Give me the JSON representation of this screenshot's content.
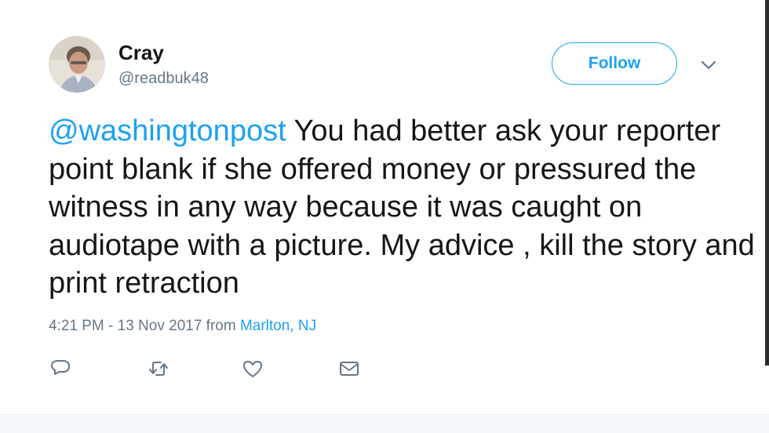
{
  "user": {
    "display_name": "Cray",
    "handle": "@readbuk48",
    "avatar_icon": "profile-photo"
  },
  "follow_button": {
    "label": "Follow"
  },
  "tweet": {
    "mention": "@washingtonpost",
    "text": " You had better ask your reporter point blank if she offered money or pressured the witness in any way because it was caught on audiotape with a picture. My advice , kill the story and print retraction",
    "time_date": "4:21 PM - 13 Nov 2017",
    "from_label": " from ",
    "location": "Marlton, NJ"
  },
  "actions": [
    {
      "icon": "reply-icon"
    },
    {
      "icon": "retweet-icon"
    },
    {
      "icon": "like-icon"
    },
    {
      "icon": "direct-message-icon"
    }
  ],
  "colors": {
    "accent": "#1da1f2",
    "text": "#14171a",
    "secondary": "#657786"
  }
}
